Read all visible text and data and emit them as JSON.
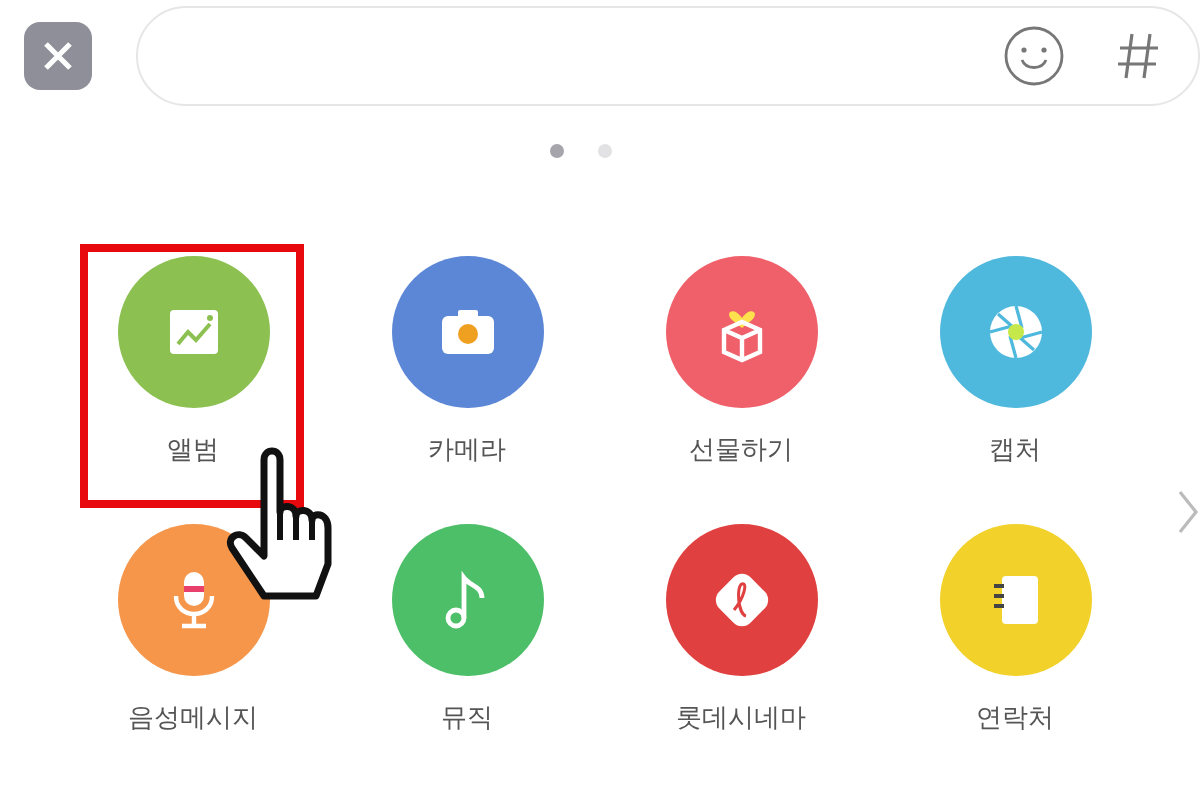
{
  "page_dots": [
    {
      "selected": true
    },
    {
      "selected": false
    }
  ],
  "items": [
    {
      "label": "앨범",
      "kind": "album",
      "color": "#8cc152",
      "highlighted": true
    },
    {
      "label": "카메라",
      "kind": "camera",
      "color": "#5b87d6",
      "highlighted": false
    },
    {
      "label": "선물하기",
      "kind": "gift",
      "color": "#f0606a",
      "highlighted": false
    },
    {
      "label": "캡처",
      "kind": "capture",
      "color": "#4fb8dd",
      "highlighted": false
    },
    {
      "label": "음성메시지",
      "kind": "voice",
      "color": "#f6964a",
      "highlighted": false
    },
    {
      "label": "뮤직",
      "kind": "music",
      "color": "#4cbf68",
      "highlighted": false
    },
    {
      "label": "롯데시네마",
      "kind": "cinema",
      "color": "#e04040",
      "highlighted": false
    },
    {
      "label": "연락처",
      "kind": "contacts",
      "color": "#f1d12a",
      "highlighted": false
    }
  ]
}
